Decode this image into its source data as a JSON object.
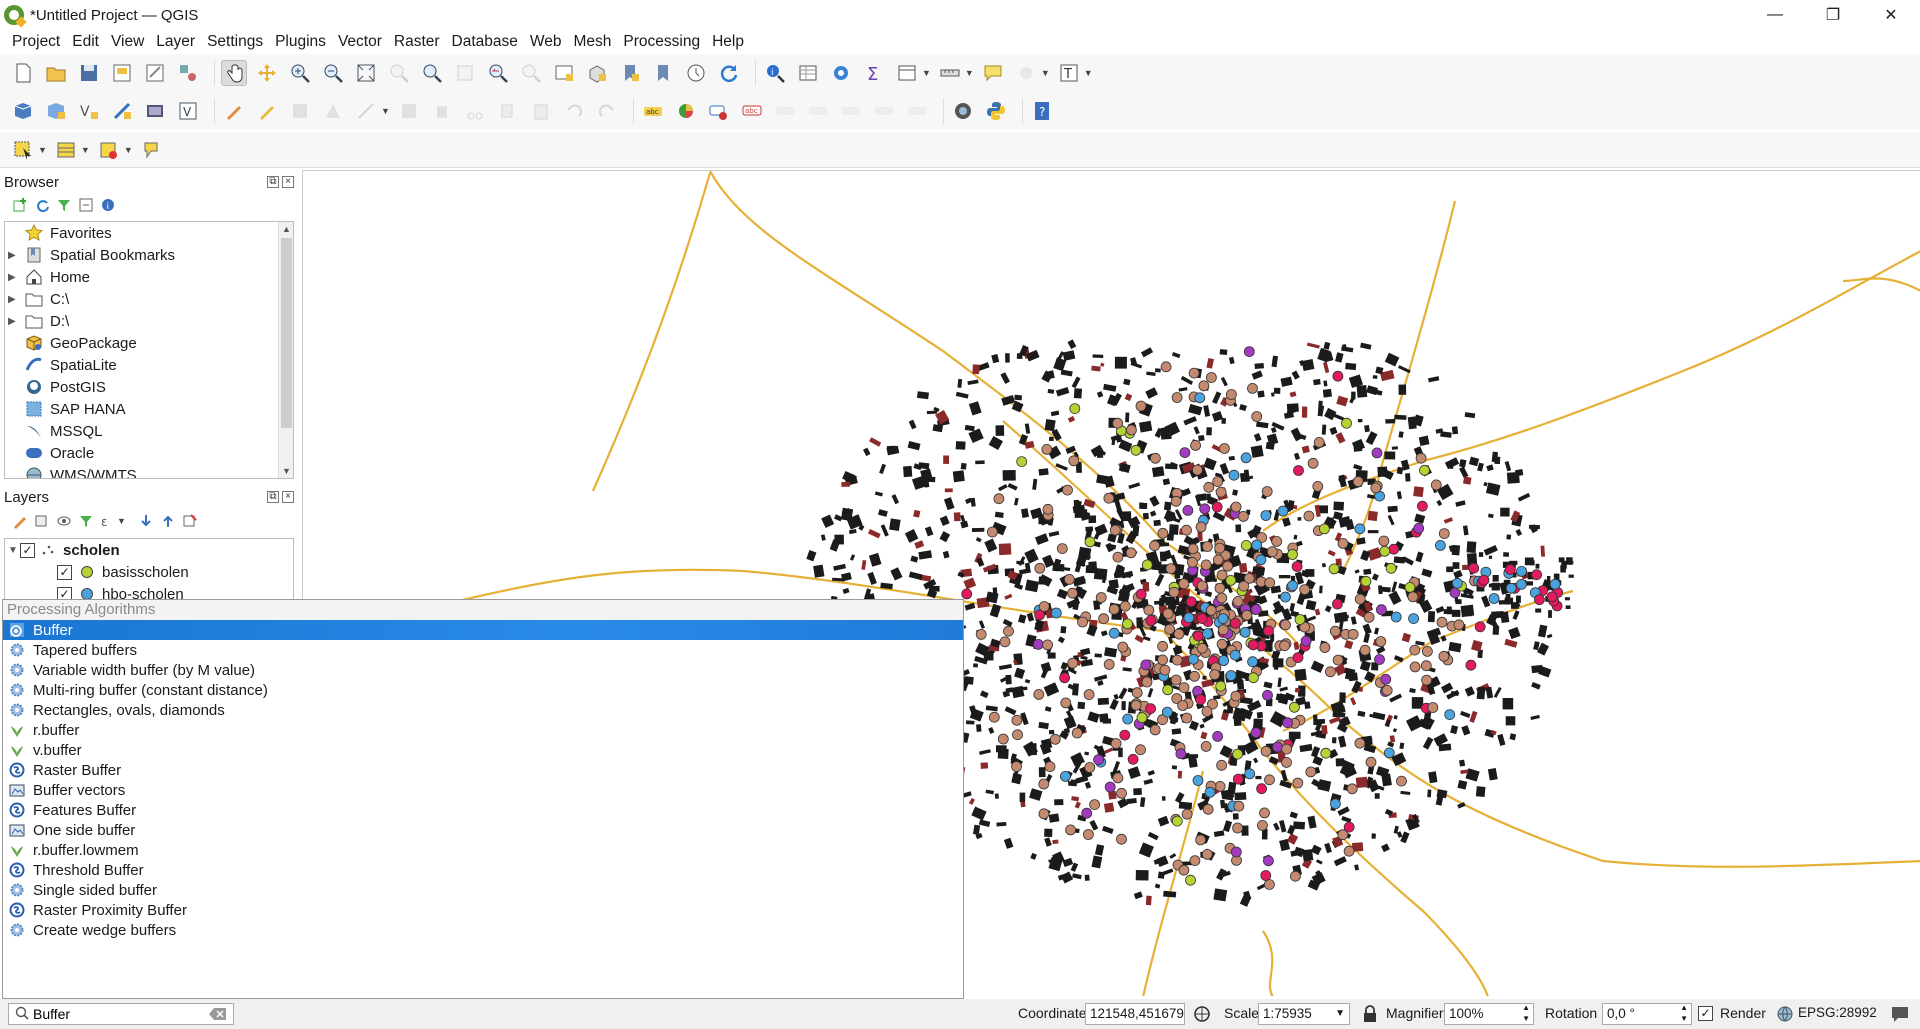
{
  "window": {
    "title": "*Untitled Project — QGIS",
    "minimize": "—",
    "maximize": "❐",
    "close": "✕"
  },
  "menu": [
    "Project",
    "Edit",
    "View",
    "Layer",
    "Settings",
    "Plugins",
    "Vector",
    "Raster",
    "Database",
    "Web",
    "Mesh",
    "Processing",
    "Help"
  ],
  "browser": {
    "title": "Browser",
    "items": [
      {
        "label": "Favorites",
        "icon": "star-icon",
        "expandable": false
      },
      {
        "label": "Spatial Bookmarks",
        "icon": "bookmark-icon",
        "expandable": true
      },
      {
        "label": "Home",
        "icon": "home-icon",
        "expandable": true
      },
      {
        "label": "C:\\",
        "icon": "folder-icon",
        "expandable": true
      },
      {
        "label": "D:\\",
        "icon": "folder-icon",
        "expandable": true
      },
      {
        "label": "GeoPackage",
        "icon": "geopackage-icon",
        "expandable": false
      },
      {
        "label": "SpatiaLite",
        "icon": "spatialite-icon",
        "expandable": false
      },
      {
        "label": "PostGIS",
        "icon": "postgis-icon",
        "expandable": false
      },
      {
        "label": "SAP HANA",
        "icon": "sap-hana-icon",
        "expandable": false
      },
      {
        "label": "MSSQL",
        "icon": "mssql-icon",
        "expandable": false
      },
      {
        "label": "Oracle",
        "icon": "oracle-icon",
        "expandable": false
      },
      {
        "label": "WMS/WMTS",
        "icon": "wms-icon",
        "expandable": false
      }
    ]
  },
  "layers": {
    "title": "Layers",
    "group": "scholen",
    "items": [
      {
        "label": "basisscholen",
        "color": "#b5d334"
      },
      {
        "label": "hbo-scholen",
        "color": "#4aa3df"
      }
    ]
  },
  "processing": {
    "header": "Processing Algorithms",
    "algorithms": [
      {
        "label": "Buffer",
        "icon": "qgis-buffer-icon",
        "selected": true
      },
      {
        "label": "Tapered buffers",
        "icon": "gear-icon"
      },
      {
        "label": "Variable width buffer (by M value)",
        "icon": "gear-icon"
      },
      {
        "label": "Multi-ring buffer (constant distance)",
        "icon": "gear-icon"
      },
      {
        "label": "Rectangles, ovals, diamonds",
        "icon": "gear-icon"
      },
      {
        "label": "r.buffer",
        "icon": "grass-icon"
      },
      {
        "label": "v.buffer",
        "icon": "grass-icon"
      },
      {
        "label": "Raster Buffer",
        "icon": "saga-icon"
      },
      {
        "label": "Buffer vectors",
        "icon": "gdal-icon"
      },
      {
        "label": "Features Buffer",
        "icon": "saga-icon"
      },
      {
        "label": "One side buffer",
        "icon": "gdal-icon"
      },
      {
        "label": "r.buffer.lowmem",
        "icon": "grass-icon"
      },
      {
        "label": "Threshold Buffer",
        "icon": "saga-icon"
      },
      {
        "label": "Single sided buffer",
        "icon": "gear-icon"
      },
      {
        "label": "Raster Proximity Buffer",
        "icon": "saga-icon"
      },
      {
        "label": "Create wedge buffers",
        "icon": "gear-icon"
      }
    ]
  },
  "statusbar": {
    "search_value": "Buffer",
    "coordinate_label": "Coordinate",
    "coordinate_value": "121548,451679",
    "scale_label": "Scale",
    "scale_value": "1:75935",
    "magnifier_label": "Magnifier",
    "magnifier_value": "100%",
    "rotation_label": "Rotation",
    "rotation_value": "0,0 °",
    "render_label": "Render",
    "crs": "EPSG:28992"
  },
  "colors": {
    "roads": "#e6b035",
    "buildings": "#1b1b1b",
    "schools": "#c48a70",
    "selection": "#1976d2"
  }
}
